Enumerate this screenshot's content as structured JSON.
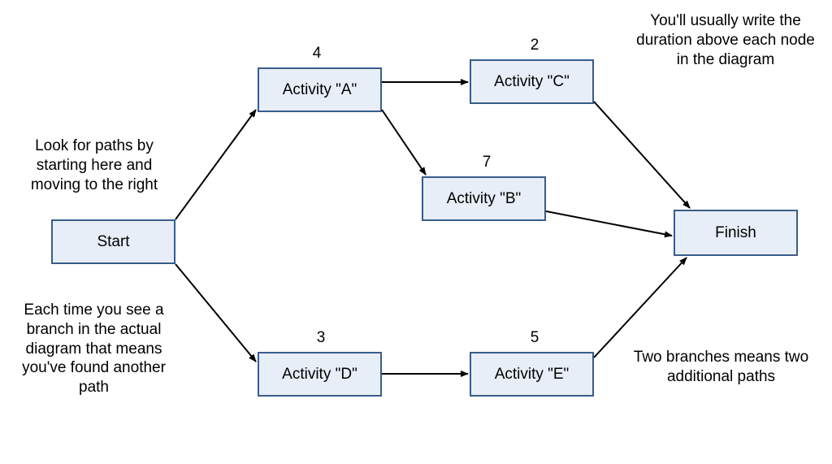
{
  "nodes": {
    "start": {
      "label": "Start"
    },
    "a": {
      "label": "Activity \"A\"",
      "duration": "4"
    },
    "b": {
      "label": "Activity \"B\"",
      "duration": "7"
    },
    "c": {
      "label": "Activity \"C\"",
      "duration": "2"
    },
    "d": {
      "label": "Activity \"D\"",
      "duration": "3"
    },
    "e": {
      "label": "Activity \"E\"",
      "duration": "5"
    },
    "finish": {
      "label": "Finish"
    }
  },
  "annotations": {
    "top_left": "Look for paths by starting here and moving to the right",
    "top_right": "You'll usually write the duration above each node in the diagram",
    "bottom_left": "Each time you see a branch in the actual diagram that means you've found another path",
    "bottom_right": "Two branches means two additional paths"
  },
  "edges": [
    {
      "from": "start",
      "to": "a"
    },
    {
      "from": "start",
      "to": "d"
    },
    {
      "from": "a",
      "to": "c"
    },
    {
      "from": "a",
      "to": "b"
    },
    {
      "from": "c",
      "to": "finish"
    },
    {
      "from": "b",
      "to": "finish"
    },
    {
      "from": "d",
      "to": "e"
    },
    {
      "from": "e",
      "to": "finish"
    }
  ],
  "colors": {
    "node_fill": "#e8eef7",
    "node_border": "#385d8a",
    "arrow": "#000000"
  }
}
